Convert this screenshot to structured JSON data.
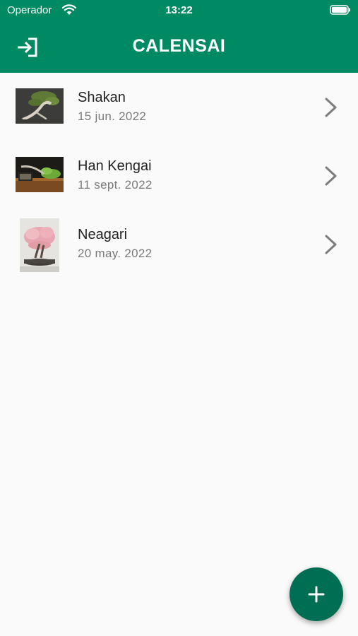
{
  "status_bar": {
    "carrier": "Operador",
    "time": "13:22",
    "wifi_icon": "wifi-icon",
    "battery_icon": "battery-icon"
  },
  "header": {
    "title": "CALENSAI",
    "login_icon": "login-icon",
    "background": "#008a63"
  },
  "bonsais": [
    {
      "name": "Shakan",
      "date": "15 jun. 2022",
      "thumbnail": "shakan-photo"
    },
    {
      "name": "Han Kengai",
      "date": "11 sept. 2022",
      "thumbnail": "han-kengai-photo"
    },
    {
      "name": "Neagari",
      "date": "20 may. 2022",
      "thumbnail": "neagari-photo"
    }
  ],
  "fab": {
    "icon": "plus-icon",
    "color": "#006e52"
  },
  "colors": {
    "accent": "#008a63",
    "fab": "#006e52",
    "background": "#fafafa"
  }
}
